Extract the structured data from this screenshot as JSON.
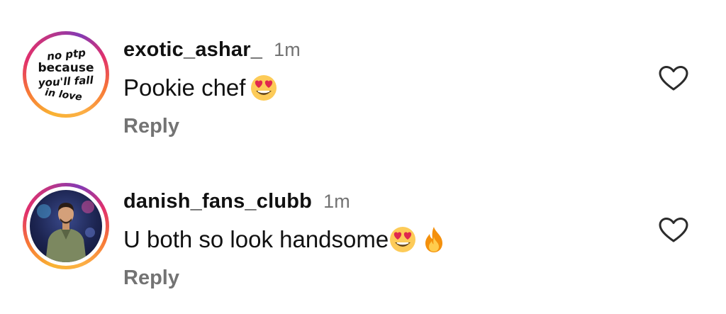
{
  "comments": [
    {
      "username": "exotic_ashar_",
      "time": "1m",
      "text": "Pookie chef",
      "emojis": [
        "heart-eyes-emoji"
      ],
      "reply_label": "Reply",
      "avatar": {
        "type": "text",
        "lines": [
          "no ptp",
          "because",
          "you'll fall",
          "in love"
        ]
      }
    },
    {
      "username": "danish_fans_clubb",
      "time": "1m",
      "text": "U both so look handsome",
      "emojis": [
        "heart-eyes-emoji",
        "fire-emoji"
      ],
      "reply_label": "Reply",
      "avatar": {
        "type": "photo"
      }
    }
  ],
  "icons": {
    "like": "heart-outline-icon"
  },
  "colors": {
    "username": "#111111",
    "secondary": "#737373",
    "story_ring_start": "#f9b233",
    "story_ring_end": "#c13584"
  }
}
